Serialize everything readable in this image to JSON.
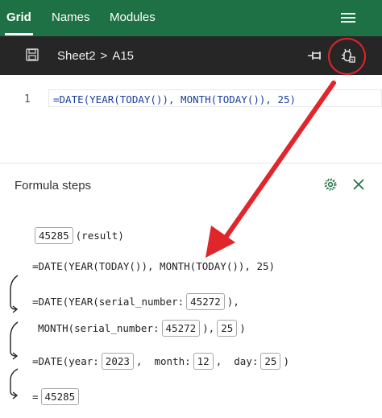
{
  "nav": {
    "tabs": [
      {
        "label": "Grid",
        "active": true
      },
      {
        "label": "Names",
        "active": false
      },
      {
        "label": "Modules",
        "active": false
      }
    ],
    "menu_icon": "hamburger-icon"
  },
  "toolbar": {
    "save_icon": "save-icon",
    "sheet": "Sheet2",
    "separator": ">",
    "cell": "A15",
    "pin_icon": "pin-icon",
    "debug_icon": "bug-icon"
  },
  "editor": {
    "line_number": "1",
    "formula": "=DATE(YEAR(TODAY()), MONTH(TODAY()), 25)"
  },
  "panel": {
    "title": "Formula steps",
    "settings_icon": "gear-icon",
    "close_icon": "close-icon",
    "steps": {
      "result_value": "45285",
      "result_label": "(result)",
      "original": "=DATE(YEAR(TODAY()), MONTH(TODAY()), 25)",
      "step2_prefix": "=DATE(YEAR(serial_number:",
      "step2_value": "45272",
      "step2_suffix": "),",
      "step3_prefix": "MONTH(serial_number:",
      "step3_value": "45272",
      "step3_mid": "),",
      "step3_day": "25",
      "step3_suffix": ")",
      "step4_prefix": "=DATE(year:",
      "step4_year": "2023",
      "step4_month_label": ",  month:",
      "step4_month": "12",
      "step4_day_label": ",  day:",
      "step4_day": "25",
      "step4_suffix": ")",
      "step5_prefix": "=",
      "step5_value": "45285"
    }
  },
  "colors": {
    "nav_bg": "#1e7145",
    "toolbar_bg": "#262626",
    "formula_text": "#1c3f9a",
    "annotation": "#e0252b"
  }
}
